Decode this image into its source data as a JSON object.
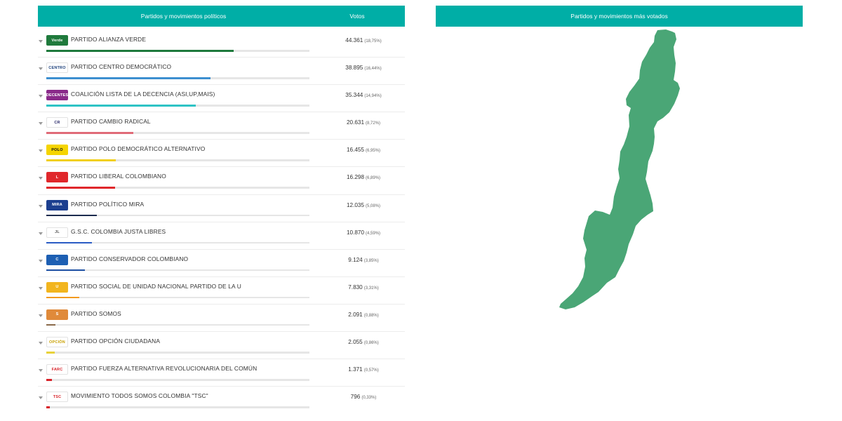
{
  "table": {
    "header_party": "Partidos y movimientos políticos",
    "header_votes": "Votos"
  },
  "map": {
    "title": "Partidos y movimientos más votados",
    "fill_color": "#4aa676"
  },
  "parties": [
    {
      "name": "PARTIDO ALIANZA VERDE",
      "votes": "44.361",
      "pct": "(18,75%)",
      "share": 18.75,
      "color": "#1f7a3c",
      "logo_text": "Verde",
      "logo_bg": "#1f7a3c",
      "logo_fg": "#ffffff"
    },
    {
      "name": "PARTIDO CENTRO DEMOCRÁTICO",
      "votes": "38.895",
      "pct": "(16,44%)",
      "share": 16.44,
      "color": "#3d8fd0",
      "logo_text": "CENTRO",
      "logo_bg": "#ffffff",
      "logo_fg": "#1b3f7a"
    },
    {
      "name": "COALICIÓN LISTA DE LA DECENCIA (ASI,UP,MAIS)",
      "votes": "35.344",
      "pct": "(14,94%)",
      "share": 14.94,
      "color": "#2ec3c5",
      "logo_text": "DECENTES",
      "logo_bg": "#8a2a8a",
      "logo_fg": "#ffffff"
    },
    {
      "name": "PARTIDO CAMBIO RADICAL",
      "votes": "20.631",
      "pct": "(8,72%)",
      "share": 8.72,
      "color": "#e06b78",
      "logo_text": "CR",
      "logo_bg": "#ffffff",
      "logo_fg": "#2a2a6a"
    },
    {
      "name": "PARTIDO POLO DEMOCRÁTICO ALTERNATIVO",
      "votes": "16.455",
      "pct": "(6,95%)",
      "share": 6.95,
      "color": "#f1cf1c",
      "logo_text": "POLO",
      "logo_bg": "#f5d400",
      "logo_fg": "#111111"
    },
    {
      "name": "PARTIDO LIBERAL COLOMBIANO",
      "votes": "16.298",
      "pct": "(6,89%)",
      "share": 6.89,
      "color": "#e0272b",
      "logo_text": "L",
      "logo_bg": "#e0272b",
      "logo_fg": "#ffffff"
    },
    {
      "name": "PARTIDO POLÍTICO MIRA",
      "votes": "12.035",
      "pct": "(5,08%)",
      "share": 5.08,
      "color": "#1c2b4f",
      "logo_text": "MIRA",
      "logo_bg": "#1c3f8f",
      "logo_fg": "#ffffff"
    },
    {
      "name": "G.S.C. COLOMBIA JUSTA LIBRES",
      "votes": "10.870",
      "pct": "(4,59%)",
      "share": 4.59,
      "color": "#2a5cc4",
      "logo_text": "JL",
      "logo_bg": "#ffffff",
      "logo_fg": "#555555"
    },
    {
      "name": "PARTIDO CONSERVADOR COLOMBIANO",
      "votes": "9.124",
      "pct": "(3,85%)",
      "share": 3.85,
      "color": "#1d4fa3",
      "logo_text": "C",
      "logo_bg": "#1d5fb3",
      "logo_fg": "#ffffff"
    },
    {
      "name": "PARTIDO SOCIAL DE UNIDAD NACIONAL PARTIDO DE LA U",
      "votes": "7.830",
      "pct": "(3,31%)",
      "share": 3.31,
      "color": "#f29a1e",
      "logo_text": "U",
      "logo_bg": "#f2b51e",
      "logo_fg": "#ffffff"
    },
    {
      "name": "PARTIDO SOMOS",
      "votes": "2.091",
      "pct": "(0,88%)",
      "share": 0.88,
      "color": "#8a6a4a",
      "logo_text": "S",
      "logo_bg": "#e08a3a",
      "logo_fg": "#ffffff"
    },
    {
      "name": "PARTIDO OPCIÓN CIUDADANA",
      "votes": "2.055",
      "pct": "(0,86%)",
      "share": 0.86,
      "color": "#e8d23a",
      "logo_text": "OPCIÓN",
      "logo_bg": "#ffffff",
      "logo_fg": "#c8a000"
    },
    {
      "name": "PARTIDO FUERZA ALTERNATIVA REVOLUCIONARIA DEL COMÚN",
      "votes": "1.371",
      "pct": "(0,57%)",
      "share": 0.57,
      "color": "#d8232a",
      "logo_text": "FARC",
      "logo_bg": "#ffffff",
      "logo_fg": "#d8232a"
    },
    {
      "name": "MOVIMIENTO TODOS SOMOS COLOMBIA \"TSC\"",
      "votes": "796",
      "pct": "(0,33%)",
      "share": 0.33,
      "color": "#d8232a",
      "logo_text": "TSC",
      "logo_bg": "#ffffff",
      "logo_fg": "#d8232a"
    }
  ]
}
